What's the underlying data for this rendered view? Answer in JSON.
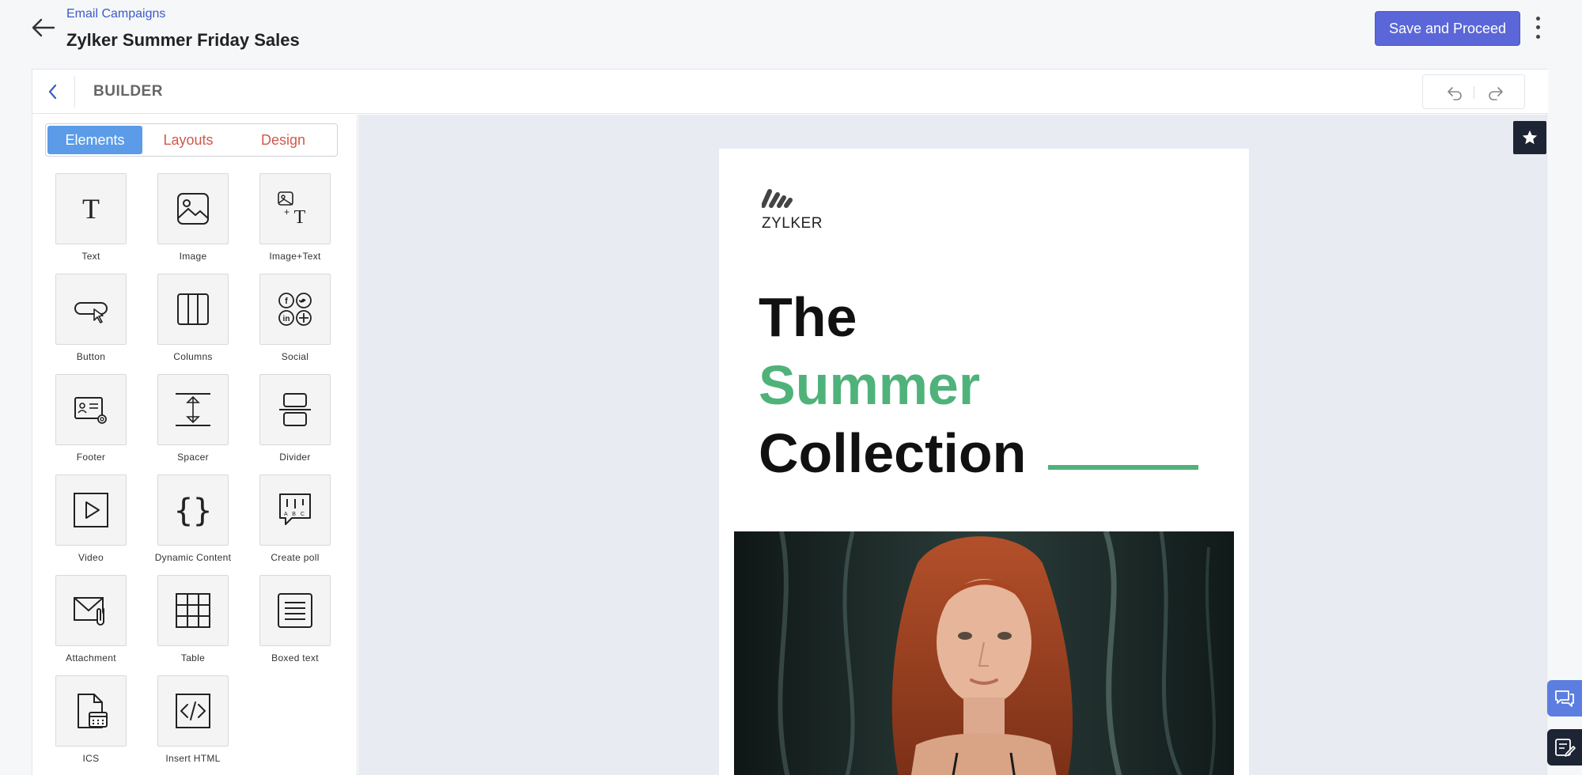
{
  "header": {
    "breadcrumb": "Email Campaigns",
    "title": "Zylker Summer Friday Sales",
    "save_label": "Save and Proceed"
  },
  "builder": {
    "label": "BUILDER"
  },
  "sidebar": {
    "tabs": [
      {
        "label": "Elements",
        "active": true
      },
      {
        "label": "Layouts",
        "active": false
      },
      {
        "label": "Design",
        "active": false
      }
    ],
    "elements": [
      {
        "label": "Text",
        "icon": "text-icon"
      },
      {
        "label": "Image",
        "icon": "image-icon"
      },
      {
        "label": "Image+Text",
        "icon": "image-text-icon"
      },
      {
        "label": "Button",
        "icon": "button-icon"
      },
      {
        "label": "Columns",
        "icon": "columns-icon"
      },
      {
        "label": "Social",
        "icon": "social-icon"
      },
      {
        "label": "Footer",
        "icon": "footer-icon"
      },
      {
        "label": "Spacer",
        "icon": "spacer-icon"
      },
      {
        "label": "Divider",
        "icon": "divider-icon"
      },
      {
        "label": "Video",
        "icon": "video-icon"
      },
      {
        "label": "Dynamic Content",
        "icon": "dynamic-content-icon"
      },
      {
        "label": "Create poll",
        "icon": "poll-icon"
      },
      {
        "label": "Attachment",
        "icon": "attachment-icon"
      },
      {
        "label": "Table",
        "icon": "table-icon"
      },
      {
        "label": "Boxed text",
        "icon": "boxed-text-icon"
      },
      {
        "label": "ICS",
        "icon": "ics-icon"
      },
      {
        "label": "Insert HTML",
        "icon": "insert-html-icon"
      }
    ]
  },
  "email": {
    "logo_text": "ZYLKER",
    "headline": [
      "The",
      "Summer",
      "Collection"
    ],
    "accent_color": "#4fb27a"
  },
  "colors": {
    "primary_button": "#5b67d8",
    "active_tab": "#5b9be8",
    "inactive_tab_text": "#d1584c",
    "link": "#3a5cc5"
  }
}
